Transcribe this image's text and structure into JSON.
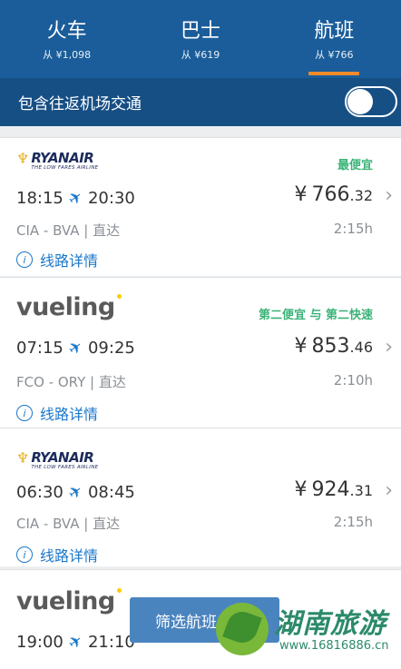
{
  "tabs": [
    {
      "label": "火车",
      "sub": "从 ¥1,098"
    },
    {
      "label": "巴士",
      "sub": "从 ¥619"
    },
    {
      "label": "航班",
      "sub": "从 ¥766",
      "active": true
    }
  ],
  "toggle": {
    "label": "包含往返机场交通",
    "on": false
  },
  "flights": [
    {
      "airline": "RYANAIR",
      "airline_tagline": "THE LOW FARES AIRLINE",
      "badge": "最便宜",
      "depart": "18:15",
      "arrive": "20:30",
      "price_currency": "¥",
      "price_main": "766",
      "price_cents": ".32",
      "route": "CIA - BVA | 直达",
      "duration": "2:15h",
      "details": "线路详情"
    },
    {
      "airline": "vueling",
      "badge": "第二便宜 与 第二快速",
      "depart": "07:15",
      "arrive": "09:25",
      "price_currency": "¥",
      "price_main": "853",
      "price_cents": ".46",
      "route": "FCO - ORY | 直达",
      "duration": "2:10h",
      "details": "线路详情"
    },
    {
      "airline": "RYANAIR",
      "airline_tagline": "THE LOW FARES AIRLINE",
      "badge": "",
      "depart": "06:30",
      "arrive": "08:45",
      "price_currency": "¥",
      "price_main": "924",
      "price_cents": ".31",
      "route": "CIA - BVA | 直达",
      "duration": "2:15h",
      "details": "线路详情"
    },
    {
      "airline": "vueling",
      "badge": "",
      "depart": "19:00",
      "arrive": "21:10",
      "price_currency": "",
      "price_main": "",
      "price_cents": "",
      "route": "",
      "duration": "",
      "details": ""
    }
  ],
  "filter_button": "筛选航班",
  "watermark": {
    "text": "湖南旅游",
    "url": "www.16816886.cn"
  },
  "colors": {
    "header": "#1a5d9a",
    "toggle_bar": "#164f84",
    "accent_tab": "#f08a2a",
    "badge": "#3bb378",
    "link": "#1a77c9"
  }
}
